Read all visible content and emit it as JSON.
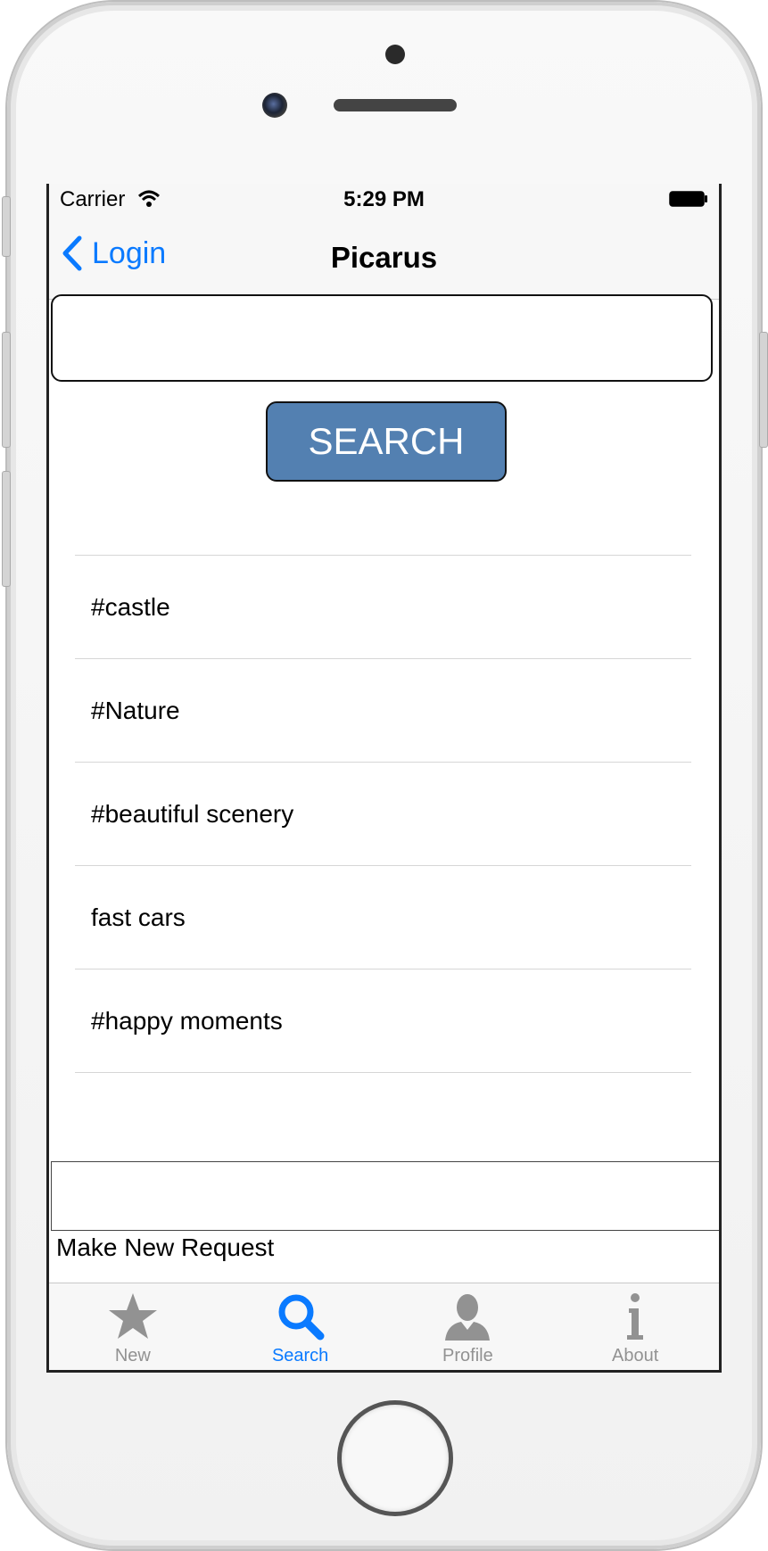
{
  "status_bar": {
    "carrier": "Carrier",
    "time": "5:29 PM"
  },
  "nav": {
    "back_label": "Login",
    "title": "Picarus"
  },
  "search": {
    "input_value": "",
    "button_label": "SEARCH"
  },
  "suggestions": [
    "#castle",
    "#Nature",
    "#beautiful scenery",
    "fast cars",
    "#happy moments"
  ],
  "request": {
    "input_value": "",
    "label": "Make New Request"
  },
  "tabs": [
    {
      "label": "New",
      "icon": "star-icon",
      "active": false
    },
    {
      "label": "Search",
      "icon": "search-icon",
      "active": true
    },
    {
      "label": "Profile",
      "icon": "person-icon",
      "active": false
    },
    {
      "label": "About",
      "icon": "info-icon",
      "active": false
    }
  ],
  "colors": {
    "accent": "#0a7aff",
    "search_button": "#5380b1",
    "tab_inactive": "#929292"
  }
}
